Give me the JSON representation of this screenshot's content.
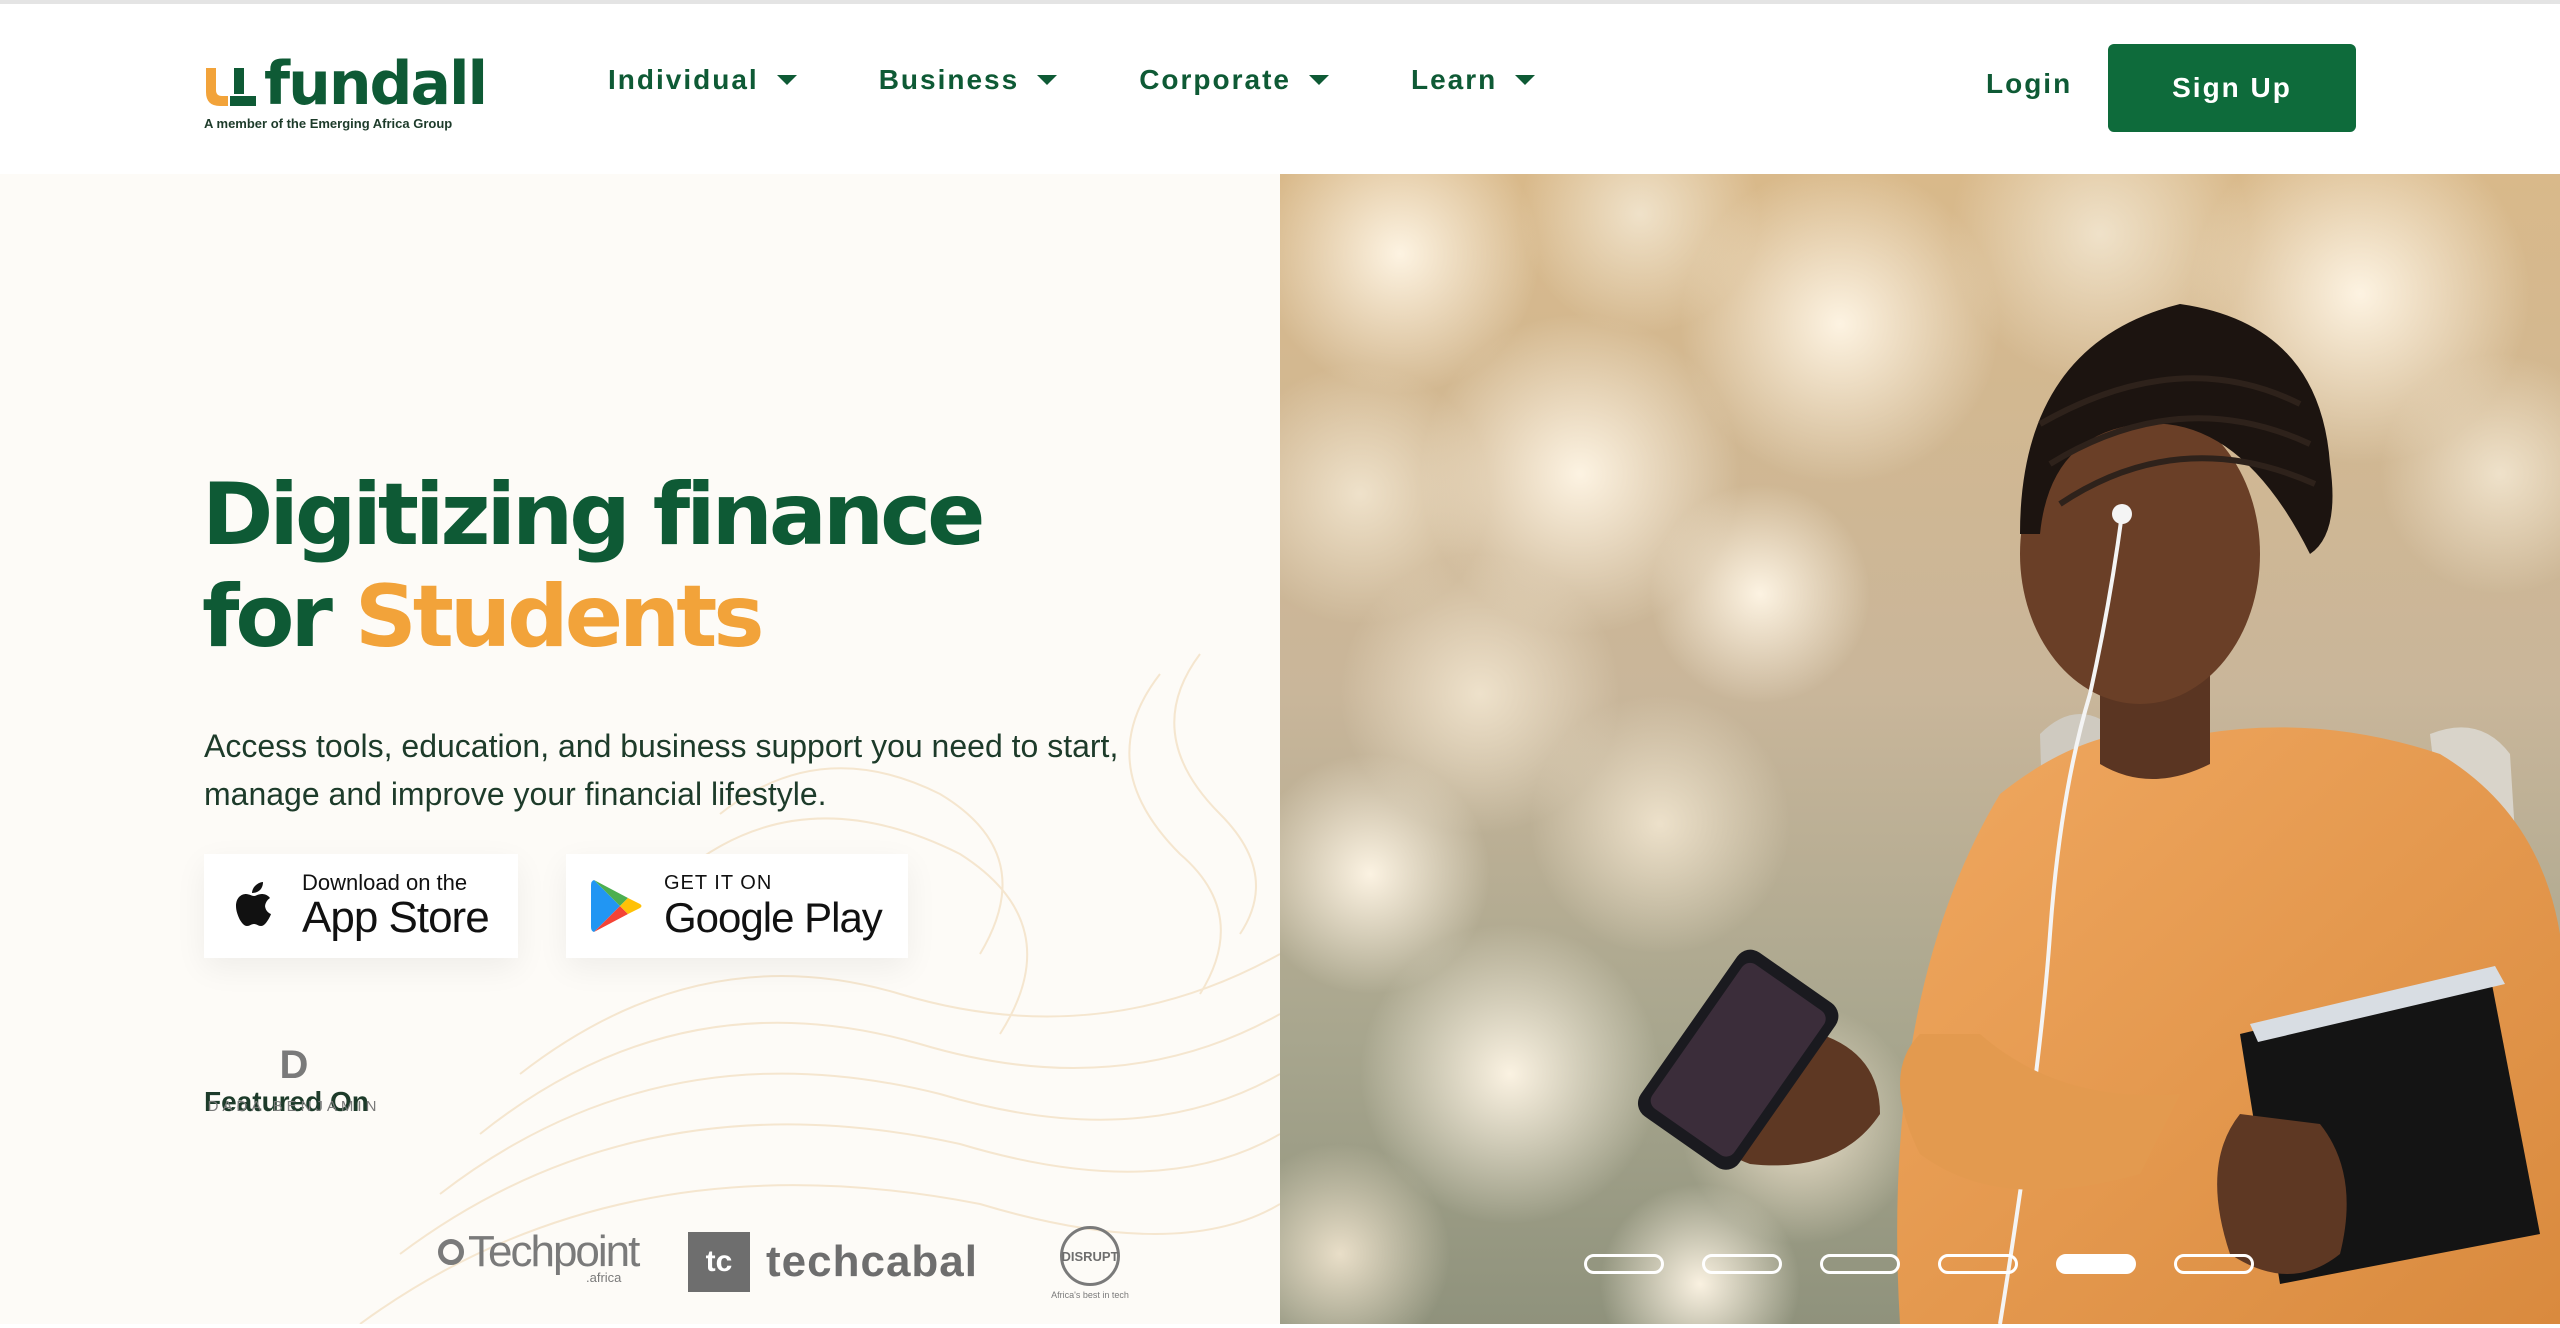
{
  "brand": {
    "name": "fundall",
    "tagline": "A member of the Emerging Africa Group",
    "colors": {
      "primary": "#0e5a35",
      "accent": "#f2a33a",
      "button": "#0e6b3b"
    }
  },
  "nav": {
    "items": [
      {
        "label": "Individual"
      },
      {
        "label": "Business"
      },
      {
        "label": "Corporate"
      },
      {
        "label": "Learn"
      }
    ],
    "login": "Login",
    "signup": "Sign Up"
  },
  "hero": {
    "headline_1": "Digitizing finance",
    "headline_2_prefix": "for ",
    "headline_2_accent": "Students",
    "subtext": "Access tools, education, and business support you need to start, manage and improve your financial lifestyle.",
    "app_store": {
      "small": "Download on the",
      "big": "App Store",
      "icon": "apple-icon"
    },
    "google_play": {
      "small": "GET IT ON",
      "big": "Google Play",
      "icon": "google-play-icon"
    },
    "featured_label": "Featured On",
    "featured": {
      "dada_mark": "D",
      "dada_name": "DADA BENJAMIN",
      "techpoint_name": "Techpoint",
      "techpoint_sub": ".africa",
      "techcabal_mark": "tc",
      "techcabal_name": "techcabal",
      "disrupt_name": "DISRUPT",
      "disrupt_sub": "Africa's best in tech"
    }
  },
  "carousel": {
    "slide_count": 6,
    "active_index": 4
  }
}
